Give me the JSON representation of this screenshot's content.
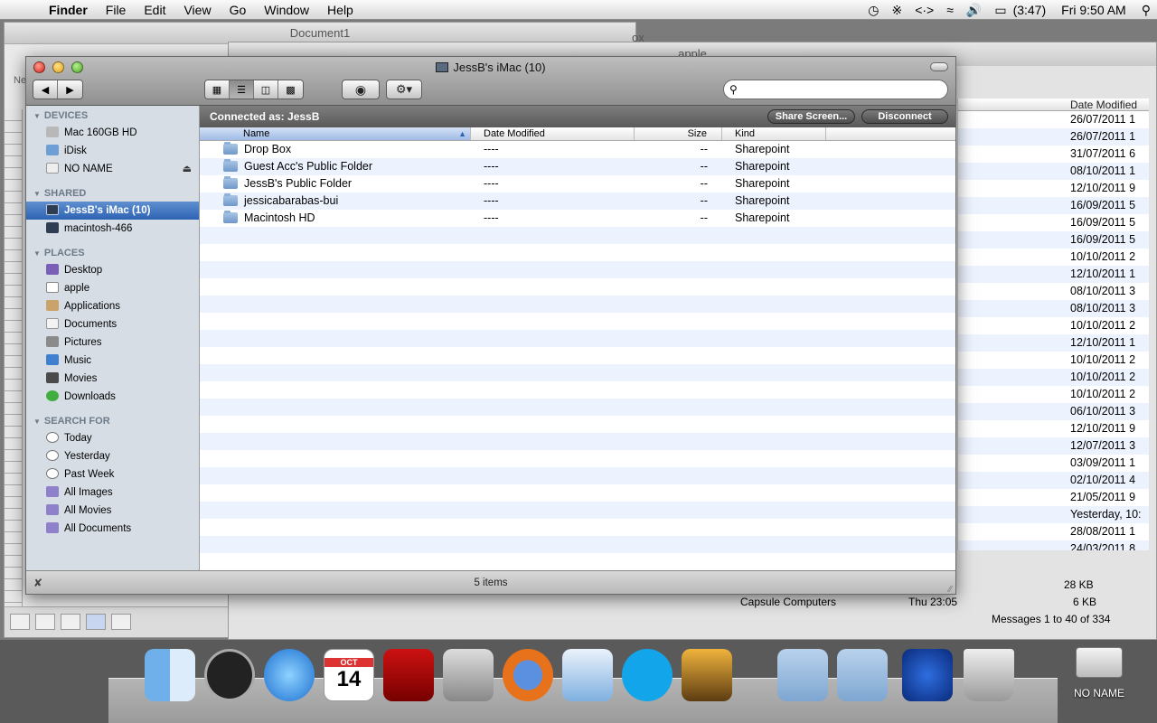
{
  "menubar": {
    "apple_icon": "apple-logo",
    "items": [
      "Finder",
      "File",
      "Edit",
      "View",
      "Go",
      "Window",
      "Help"
    ],
    "battery": "(3:47)",
    "clock": "Fri 9:50 AM"
  },
  "doc_window": {
    "title": "Document1",
    "fragment": "Ne"
  },
  "mail_window": {
    "title": "apple",
    "title_fragment": "ox",
    "column_header": "Date Modified",
    "dates": [
      "26/07/2011 1",
      "26/07/2011 1",
      "31/07/2011 6",
      "08/10/2011 1",
      "12/10/2011 9",
      "16/09/2011 5",
      "16/09/2011 5",
      "16/09/2011 5",
      "10/10/2011 2",
      "12/10/2011 1",
      "08/10/2011 3",
      "08/10/2011 3",
      "10/10/2011 2",
      "12/10/2011 1",
      "10/10/2011 2",
      "10/10/2011 2",
      "10/10/2011 2",
      "06/10/2011 3",
      "12/10/2011 9",
      "12/07/2011 3",
      "03/09/2011 1",
      "02/10/2011 4",
      "21/05/2011 9",
      "Yesterday, 10:",
      "28/08/2011 1",
      "24/03/2011 8"
    ],
    "extra_row": {
      "from": "Capsule Computers",
      "date": "Thu 23:05",
      "size": "6 KB"
    },
    "size_partial": "28 KB",
    "pager": "Messages 1 to 40 of 334"
  },
  "finder": {
    "title": "JessB's iMac (10)",
    "search_placeholder": "",
    "connected_as": "Connected as: JessB",
    "share_screen": "Share Screen...",
    "disconnect": "Disconnect",
    "status": "5 items",
    "sidebar": {
      "devices_header": "DEVICES",
      "devices": [
        "Mac 160GB HD",
        "iDisk",
        "NO NAME"
      ],
      "shared_header": "SHARED",
      "shared": [
        "JessB's iMac (10)",
        "macintosh-466"
      ],
      "places_header": "PLACES",
      "places": [
        "Desktop",
        "apple",
        "Applications",
        "Documents",
        "Pictures",
        "Music",
        "Movies",
        "Downloads"
      ],
      "search_header": "SEARCH FOR",
      "search": [
        "Today",
        "Yesterday",
        "Past Week",
        "All Images",
        "All Movies",
        "All Documents"
      ]
    },
    "columns": [
      "Name",
      "Date Modified",
      "Size",
      "Kind"
    ],
    "rows": [
      {
        "name": "Drop Box",
        "date": "----",
        "size": "--",
        "kind": "Sharepoint"
      },
      {
        "name": "Guest Acc's Public Folder",
        "date": "----",
        "size": "--",
        "kind": "Sharepoint"
      },
      {
        "name": "JessB's Public Folder",
        "date": "----",
        "size": "--",
        "kind": "Sharepoint"
      },
      {
        "name": "jessicabarabas-bui",
        "date": "----",
        "size": "--",
        "kind": "Sharepoint"
      },
      {
        "name": "Macintosh HD",
        "date": "----",
        "size": "--",
        "kind": "Sharepoint"
      }
    ]
  },
  "dock": {
    "icons": [
      "finder-icon",
      "dashboard-icon",
      "itunes-icon",
      "ical-icon",
      "photobooth-icon",
      "system-preferences-icon",
      "firefox-icon",
      "word-icon",
      "skype-icon",
      "iphoto-icon",
      "applications-folder-icon",
      "documents-folder-icon",
      "frog-app-icon",
      "trash-icon"
    ],
    "ical_month": "OCT",
    "ical_day": "14",
    "drive_label": "NO NAME"
  }
}
